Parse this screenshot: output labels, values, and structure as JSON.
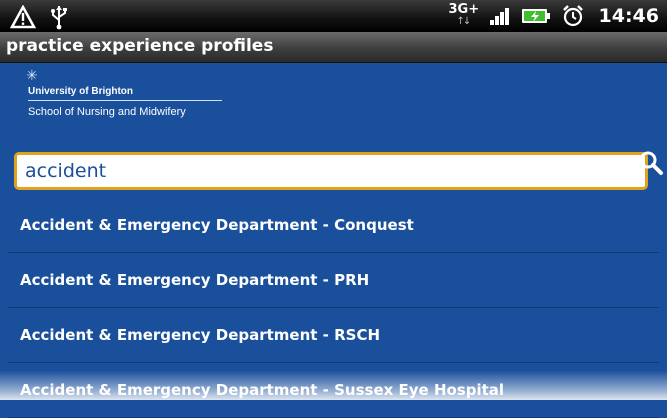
{
  "status": {
    "icons": [
      "warning-triangle-icon",
      "usb-icon"
    ],
    "network": "3G+",
    "time": "14:46"
  },
  "app": {
    "title": "practice experience profiles"
  },
  "logo": {
    "university": "University of Brighton",
    "school": "School of Nursing and Midwifery"
  },
  "search": {
    "value": "accident"
  },
  "results": [
    "Accident & Emergency Department - Conquest",
    "Accident & Emergency Department - PRH",
    "Accident & Emergency Department - RSCH",
    "Accident & Emergency Department - Sussex Eye Hospital"
  ],
  "colors": {
    "background": "#1a4f9c",
    "accent": "#e0a31d"
  }
}
